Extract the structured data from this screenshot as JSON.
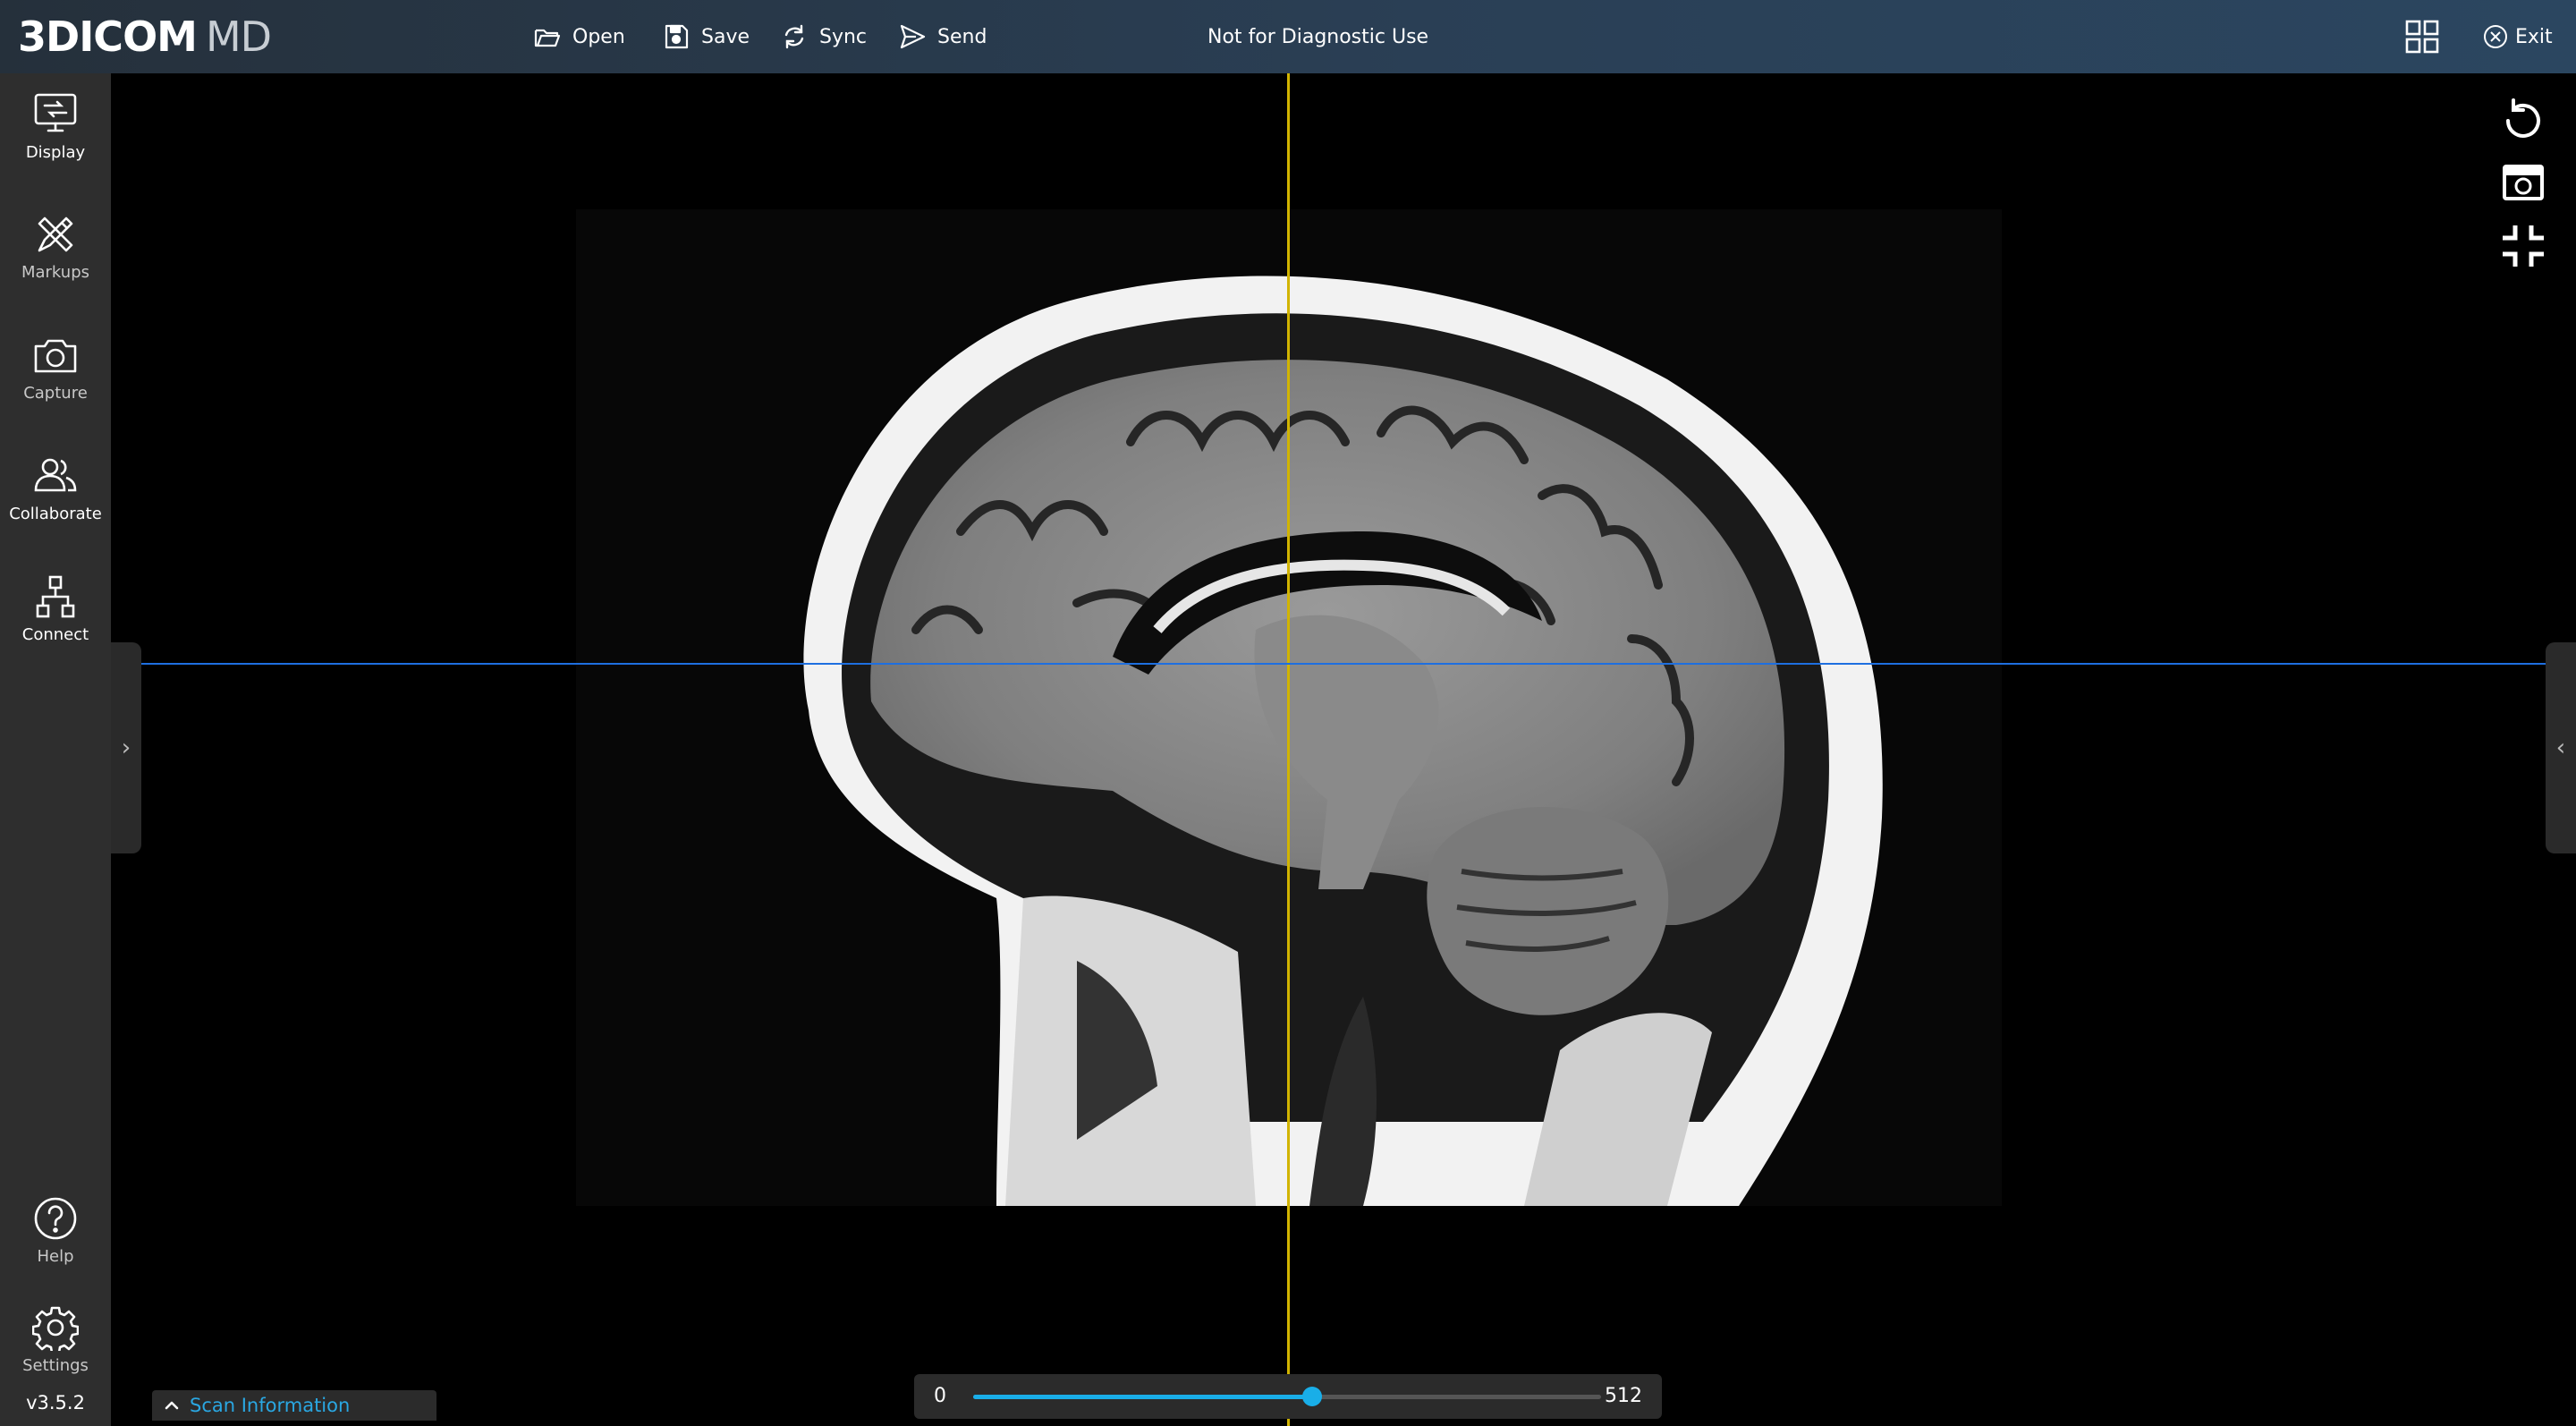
{
  "app": {
    "logo_bold": "3DICOM",
    "logo_light": "MD"
  },
  "toolbar": {
    "open_label": "Open",
    "save_label": "Save",
    "sync_label": "Sync",
    "send_label": "Send",
    "notice": "Not for Diagnostic Use",
    "exit_label": "Exit"
  },
  "sidebar": {
    "items": [
      {
        "label": "Display",
        "icon": "display-icon"
      },
      {
        "label": "Markups",
        "icon": "markups-icon"
      },
      {
        "label": "Capture",
        "icon": "camera-icon"
      },
      {
        "label": "Collaborate",
        "icon": "collaborate-icon"
      },
      {
        "label": "Connect",
        "icon": "connect-icon"
      }
    ],
    "bottom_items": [
      {
        "label": "Help",
        "icon": "help-icon"
      },
      {
        "label": "Settings",
        "icon": "settings-icon"
      }
    ],
    "version": "v3.5.2"
  },
  "viewport": {
    "view": "sagittal",
    "crosshair_colors": {
      "vertical": "#d1b400",
      "horizontal": "#1e6fe0"
    },
    "tools": [
      "reset-icon",
      "snapshot-icon",
      "exit-fullscreen-icon"
    ]
  },
  "slice_slider": {
    "min": "0",
    "max": "512",
    "value_fraction": 0.54,
    "accent": "#19aee8"
  },
  "scan_info": {
    "label": "Scan Information"
  },
  "colors": {
    "accent": "#19aee8",
    "link": "#2aa7e2",
    "sidebar": "#2e2e2e"
  }
}
